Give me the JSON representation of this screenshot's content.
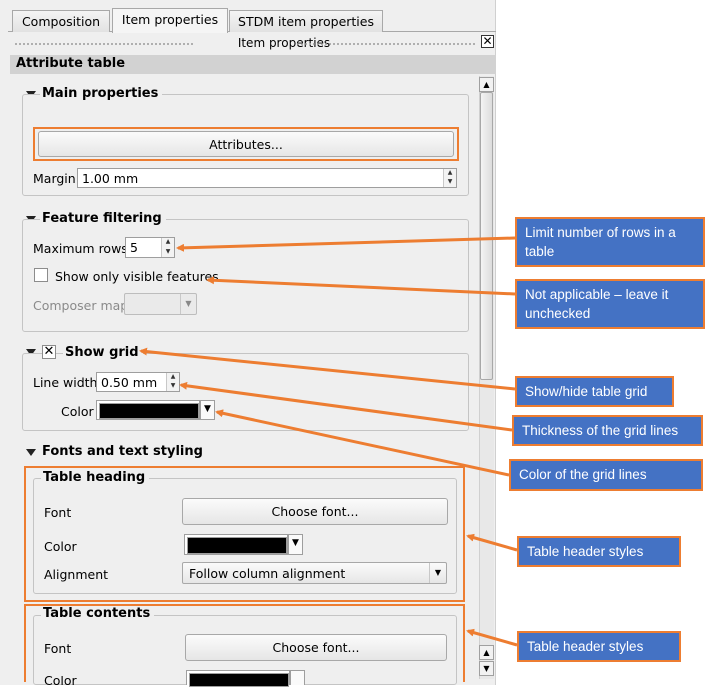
{
  "tabs": [
    {
      "label": "Composition"
    },
    {
      "label": "Item properties"
    },
    {
      "label": "STDM item properties"
    }
  ],
  "dock_title": "Item properties",
  "close_glyph": "✕",
  "section_title": "Attribute table",
  "main_properties": {
    "title": "Main properties",
    "attributes_button": "Attributes...",
    "margin_label": "Margin",
    "margin_value": "1.00 mm"
  },
  "feature_filtering": {
    "title": "Feature filtering",
    "max_rows_label": "Maximum rows",
    "max_rows_value": "5",
    "visible_only_label": "Show only visible features",
    "visible_only_checked": false,
    "composer_map_label": "Composer map",
    "composer_map_value": ""
  },
  "show_grid": {
    "title": "Show grid",
    "checked": true,
    "line_width_label": "Line width",
    "line_width_value": "0.50 mm",
    "color_label": "Color",
    "color_value": "#000000"
  },
  "fonts": {
    "title": "Fonts and text styling",
    "table_heading": {
      "title": "Table heading",
      "font_label": "Font",
      "font_button": "Choose font...",
      "color_label": "Color",
      "color_value": "#000000",
      "alignment_label": "Alignment",
      "alignment_value": "Follow column alignment"
    },
    "table_contents": {
      "title": "Table contents",
      "font_label": "Font",
      "font_button": "Choose font...",
      "color_label": "Color",
      "color_value": "#000000"
    }
  },
  "callouts": [
    {
      "text": "Limit number of rows in a table"
    },
    {
      "text": "Not applicable – leave it unchecked"
    },
    {
      "text": "Show/hide  table grid"
    },
    {
      "text": "Thickness of the grid lines"
    },
    {
      "text": "Color of the grid lines"
    },
    {
      "text": "Table header styles"
    },
    {
      "text": "Table header styles"
    }
  ],
  "colors": {
    "accent_orange": "#ed7d31",
    "callout_blue": "#4472c4"
  }
}
